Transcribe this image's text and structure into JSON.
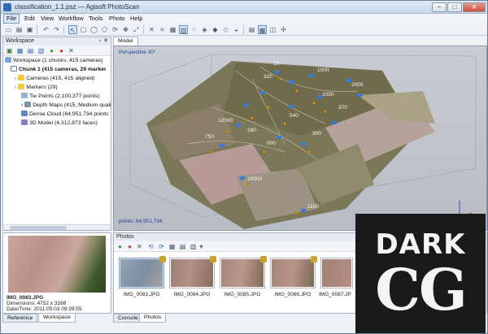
{
  "window": {
    "title": "classification_1.1.psz — Agisoft PhotoScan"
  },
  "menu": [
    "File",
    "Edit",
    "View",
    "Workflow",
    "Tools",
    "Photo",
    "Help"
  ],
  "workspace": {
    "title": "Workspace",
    "tree": [
      "Workspace (1 chunks, 415 cameras)",
      "Chunk 1 (415 cameras, 29 marker",
      "Cameras (415, 415 aligned)",
      "Markers (29)",
      "Tie Points (2,100,377 points)",
      "Depth Maps (415, Medium quali",
      "Dense Cloud (64,951,734 points",
      "3D Model (4,312,873 faces)"
    ]
  },
  "preview": {
    "filename": "IMG_0083.JPG",
    "dimensions": "Dimensions: 4752 x 3168",
    "datetime": "Date/Time: 2011:05:03 09:39:55"
  },
  "left_tabs": [
    "Reference",
    "Workspace"
  ],
  "model": {
    "tab": "Model",
    "perspective": "Perspective 30°",
    "points": "points: 64,951,734",
    "labels": [
      "10",
      "320",
      "1000",
      "2000",
      "1050",
      "370",
      "12000",
      "540",
      "180",
      "300",
      "000",
      "750",
      "10000",
      "1100"
    ]
  },
  "photos": {
    "title": "Photos",
    "items": [
      "IMG_0083.JPG",
      "IMG_0084.JPG",
      "IMG_0085.JPG",
      "IMG_0086.JPG",
      "IMG_0087.JP"
    ],
    "tabs": [
      "Console",
      "Photos"
    ]
  },
  "watermark": {
    "line1": "DARK",
    "line2": "CG"
  },
  "colors": {
    "accent": "#2e6cb3",
    "marker": "#d19a20",
    "camera": "#3b78d8"
  }
}
